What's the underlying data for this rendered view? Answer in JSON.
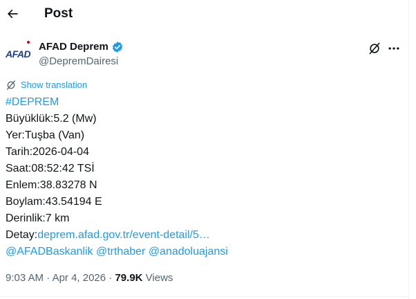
{
  "header": {
    "title": "Post"
  },
  "author": {
    "avatar_text": "AFAD",
    "display_name": "AFAD Deprem",
    "handle": "@DepremDairesi"
  },
  "translate": {
    "label": "Show translation"
  },
  "tweet": {
    "hashtag": "#DEPREM",
    "magnitude": "Büyüklük:5.2 (Mw)",
    "location": "Yer:Tuşba (Van)",
    "date": "Tarih:2026-04-04",
    "time": "Saat:08:52:42 TSİ",
    "latitude": "Enlem:38.83278 N",
    "longitude": "Boylam:43.54194 E",
    "depth": "Derinlik:7 km",
    "detail_prefix": "Detay:",
    "detail_link": "deprem.afad.gov.tr/event-detail/5…",
    "mentions": [
      "@AFADBaskanlik",
      "@trthaber",
      "@anadoluajansi"
    ]
  },
  "meta": {
    "time": "9:03 AM",
    "separator": " · ",
    "date": "Apr 4, 2026",
    "dot": " · ",
    "views_count": "79.9K",
    "views_label": " Views"
  },
  "colors": {
    "link": "#1d9bf0",
    "text": "#0f1419",
    "muted": "#536471",
    "verified": "#1d9bf0"
  }
}
